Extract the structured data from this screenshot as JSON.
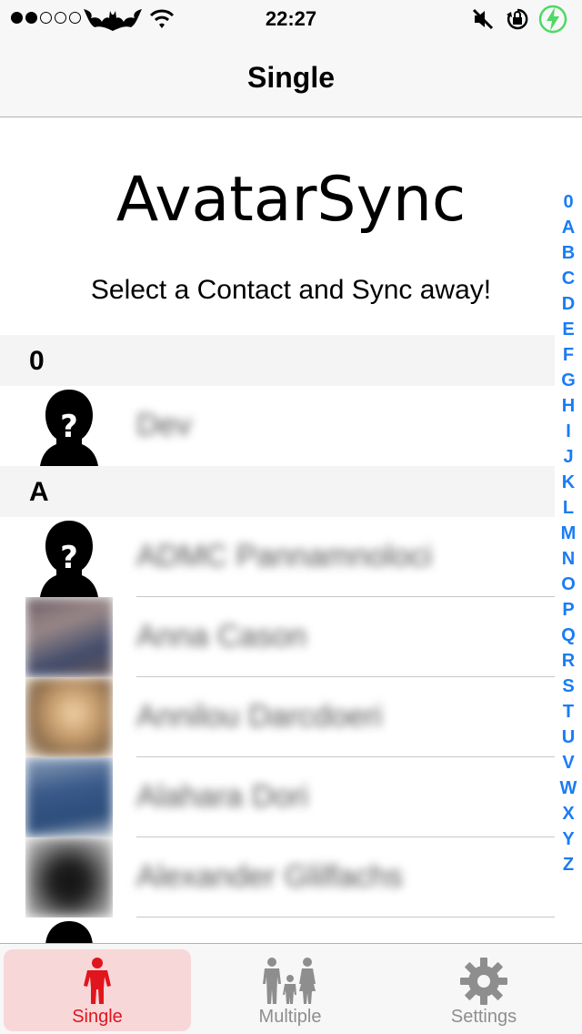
{
  "status_bar": {
    "time": "22:27",
    "signal_bars_filled": 2,
    "signal_bars_total": 5,
    "carrier_icon": "bat-logo-icon",
    "wifi_icon": "wifi-icon",
    "mute_icon": "mute-icon",
    "orientation_lock_icon": "orientation-lock-icon",
    "battery_icon": "battery-charging-icon"
  },
  "nav": {
    "title": "Single"
  },
  "header": {
    "app_title": "AvatarSync",
    "subtitle": "Select a Contact and Sync away!"
  },
  "sections": [
    {
      "letter": "0",
      "contacts": [
        {
          "name": "Dev",
          "avatar": "placeholder-silhouette-icon"
        }
      ]
    },
    {
      "letter": "A",
      "contacts": [
        {
          "name": "ADMC Pannamnoloci",
          "avatar": "placeholder-silhouette-icon"
        },
        {
          "name": "Anna Cason",
          "avatar": "photo"
        },
        {
          "name": "Annilou Darcdoeri",
          "avatar": "photo"
        },
        {
          "name": "Alahara Dori",
          "avatar": "photo"
        },
        {
          "name": "Alexander Glilfachs",
          "avatar": "photo"
        }
      ]
    }
  ],
  "index_letters": [
    "0",
    "A",
    "B",
    "C",
    "D",
    "E",
    "F",
    "G",
    "H",
    "I",
    "J",
    "K",
    "L",
    "M",
    "N",
    "O",
    "P",
    "Q",
    "R",
    "S",
    "T",
    "U",
    "V",
    "W",
    "X",
    "Y",
    "Z"
  ],
  "tabs": [
    {
      "label": "Single",
      "icon": "person-icon",
      "selected": true
    },
    {
      "label": "Multiple",
      "icon": "family-icon",
      "selected": false
    },
    {
      "label": "Settings",
      "icon": "gear-icon",
      "selected": false
    }
  ],
  "colors": {
    "accent": "#e0151d",
    "index_blue": "#1a7cf5",
    "tab_selected_bg": "#f8d7d9"
  }
}
